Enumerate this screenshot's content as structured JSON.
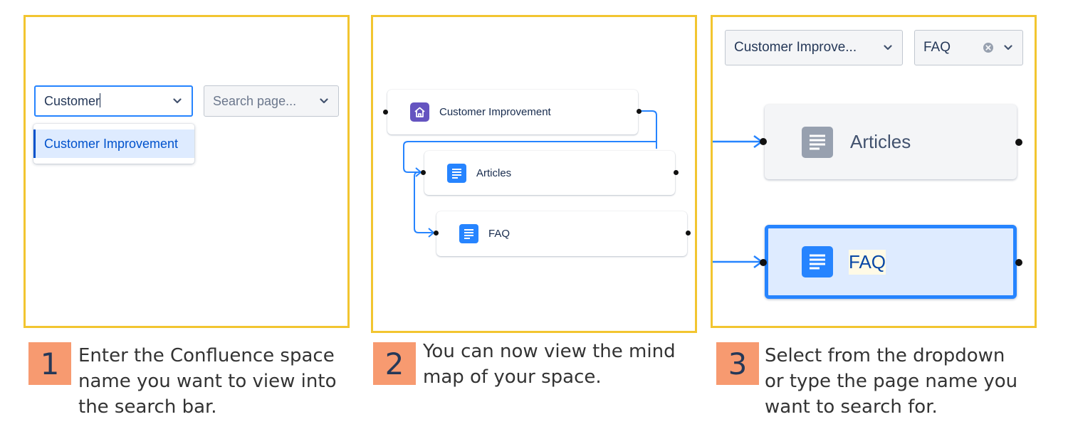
{
  "panel1": {
    "space_input_value": "Customer",
    "page_select_placeholder": "Search page...",
    "dropdown_option": "Customer Improvement"
  },
  "panel2": {
    "root_node": "Customer Improvement",
    "child_node_1": "Articles",
    "child_node_2": "FAQ"
  },
  "panel3": {
    "space_select_value": "Customer Improve...",
    "page_select_value": "FAQ",
    "node_1": "Articles",
    "node_2_selected": "FAQ"
  },
  "steps": [
    {
      "number": "1",
      "text": "Enter the Confluence space name you want to view into the search bar."
    },
    {
      "number": "2",
      "text": "You can now view the mind map of your space."
    },
    {
      "number": "3",
      "text": "Select from the dropdown or type the page name you want to search for."
    }
  ],
  "colors": {
    "panel_border": "#f2c530",
    "step_badge": "#f79a70",
    "connector": "#2684ff",
    "space_icon": "#6554c0",
    "page_icon": "#2684ff",
    "selected_node_fill": "#deebff"
  },
  "icons": {
    "chevron": "chevron-down-icon",
    "clear": "clear-icon",
    "space": "home-icon",
    "page": "document-icon"
  }
}
